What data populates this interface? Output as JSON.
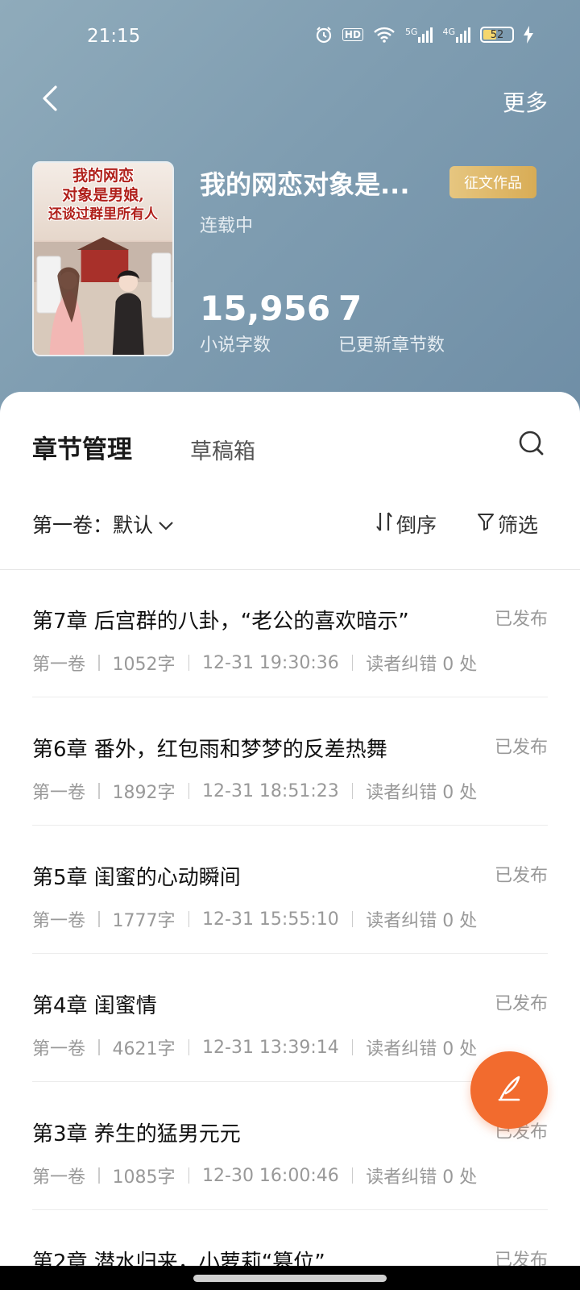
{
  "status_bar": {
    "time": "21:15",
    "hd_label": "HD",
    "net1": "5G",
    "net2": "4G",
    "battery": "52",
    "battery_level": 0.52
  },
  "nav": {
    "more_label": "更多"
  },
  "book": {
    "cover_title_lines": [
      "我的网恋",
      "对象是男娘,",
      "还谈过群里所有人"
    ],
    "title": "我的网恋对象是...",
    "badge": "征文作品",
    "status": "连载中",
    "word_count": "15,956",
    "word_count_label": "小说字数",
    "chapters": "7",
    "chapters_label": "已更新章节数"
  },
  "tabs": {
    "active": "章节管理",
    "inactive": "草稿箱"
  },
  "toolbar": {
    "volume": "第一卷：默认",
    "sort": "倒序",
    "filter": "筛选"
  },
  "chapters": [
    {
      "title": "第7章 后宫群的八卦，“老公的喜欢暗示”",
      "status": "已发布",
      "volume": "第一卷",
      "words": "1052字",
      "time": "12-31 19:30:36",
      "corrections": "读者纠错 0 处"
    },
    {
      "title": "第6章 番外，红包雨和梦梦的反差热舞",
      "status": "已发布",
      "volume": "第一卷",
      "words": "1892字",
      "time": "12-31 18:51:23",
      "corrections": "读者纠错 0 处"
    },
    {
      "title": "第5章 闺蜜的心动瞬间",
      "status": "已发布",
      "volume": "第一卷",
      "words": "1777字",
      "time": "12-31 15:55:10",
      "corrections": "读者纠错 0 处"
    },
    {
      "title": "第4章 闺蜜情",
      "status": "已发布",
      "volume": "第一卷",
      "words": "4621字",
      "time": "12-31 13:39:14",
      "corrections": "读者纠错 0 处"
    },
    {
      "title": "第3章 养生的猛男元元",
      "status": "已发布",
      "volume": "第一卷",
      "words": "1085字",
      "time": "12-30 16:00:46",
      "corrections": "读者纠错 0 处"
    },
    {
      "title": "第2章 潜水归来，小萝莉“篡位”",
      "status": "已发布",
      "volume": "",
      "words": "",
      "time": "",
      "corrections": ""
    }
  ],
  "icons": {
    "back": "chevron-left-icon",
    "search": "search-icon",
    "sort": "sort-icon",
    "filter": "filter-icon",
    "dropdown": "chevron-down-icon",
    "fab": "quill-icon"
  },
  "colors": {
    "header_bg": "#7f9db1",
    "badge": "#d8ac55",
    "fab": "#f26b2e"
  }
}
